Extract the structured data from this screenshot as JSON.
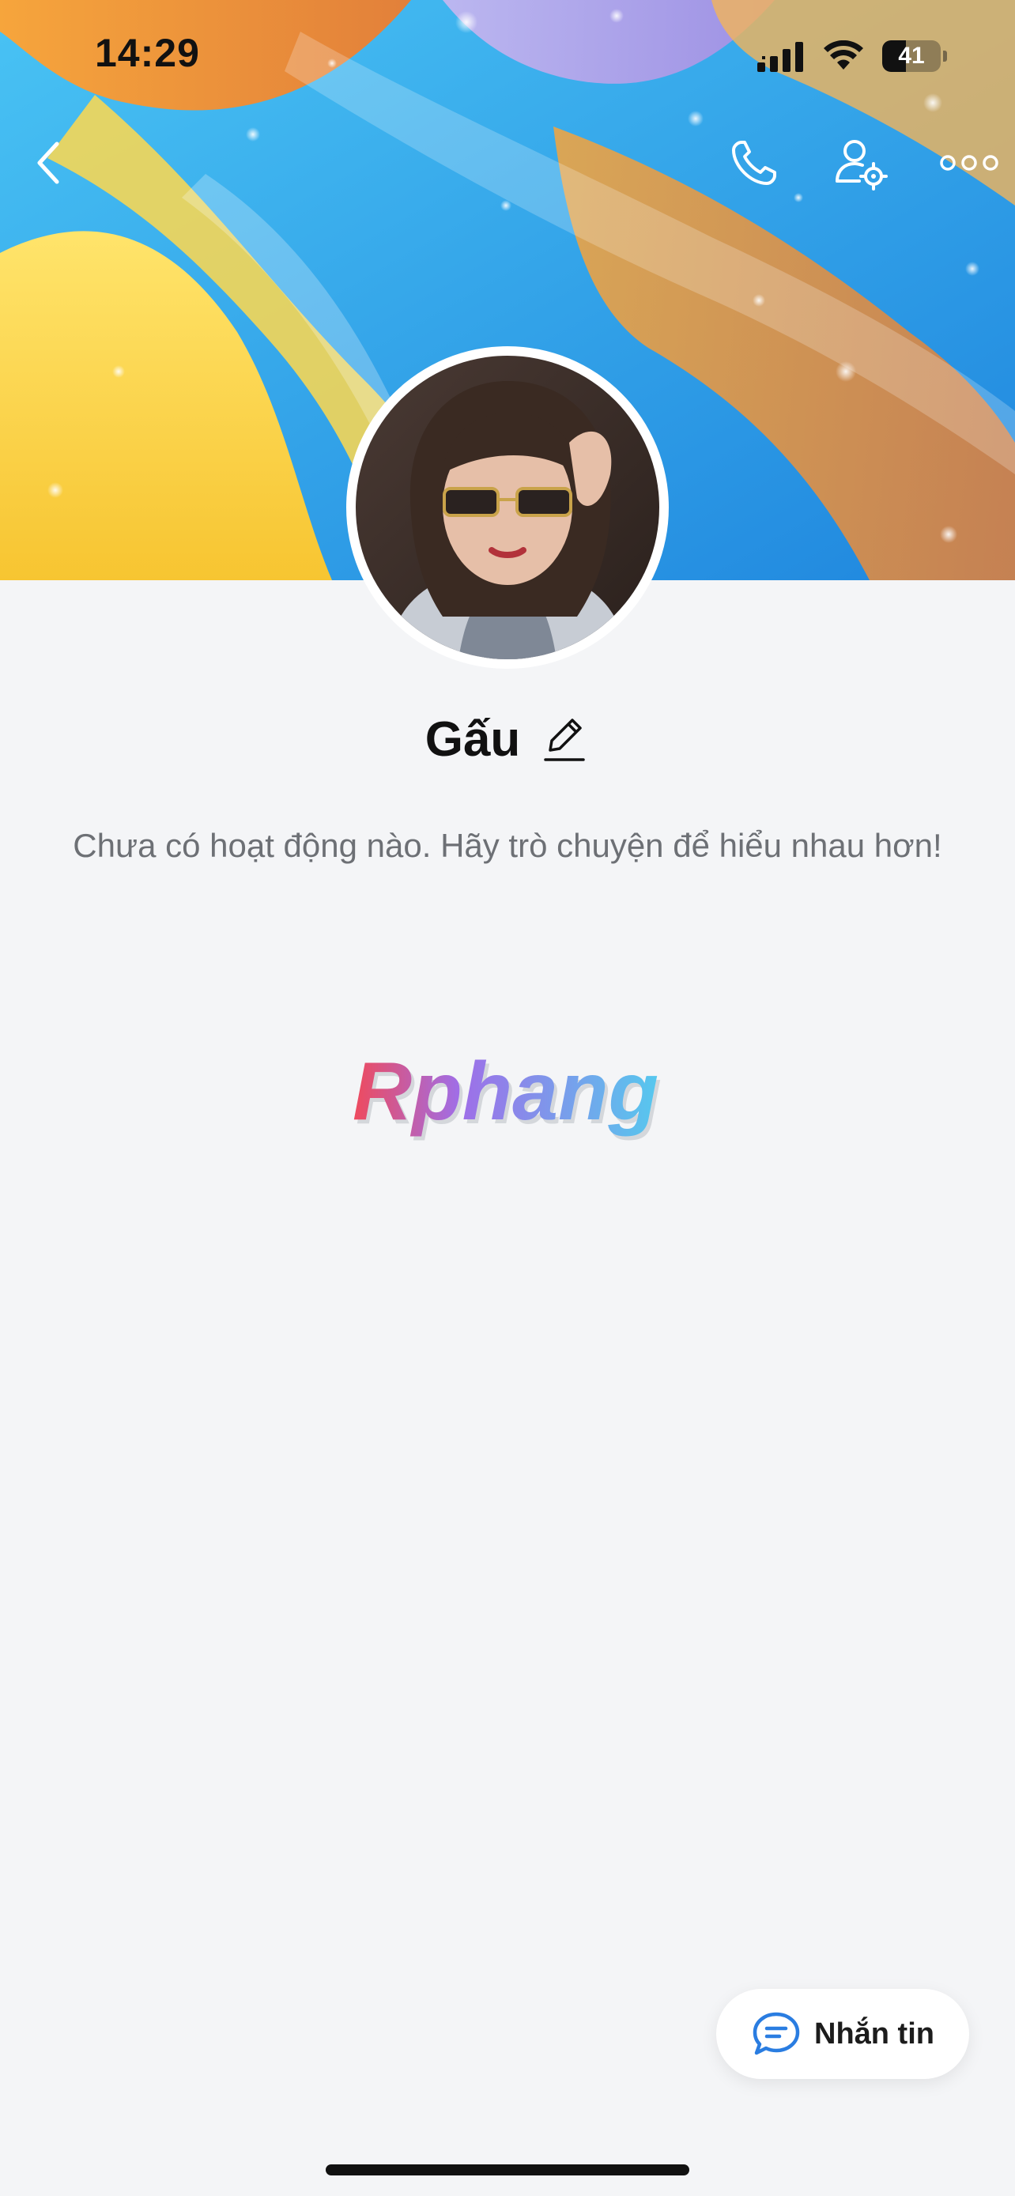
{
  "status_bar": {
    "time": "14:29",
    "battery_level": "41",
    "icons": [
      "cellular-signal-icon",
      "wifi-icon",
      "battery-icon"
    ]
  },
  "nav": {
    "icons": [
      "back-chevron-icon",
      "phone-icon",
      "user-settings-icon",
      "more-dots-icon"
    ]
  },
  "profile": {
    "name": "Gấu",
    "edit_icon": "pencil-icon",
    "empty_activity_text": "Chưa có hoạt động nào. Hãy trò chuyện để hiểu nhau hơn!"
  },
  "watermark": {
    "text": "Rphang"
  },
  "message_button": {
    "label": "Nhắn tin",
    "icon": "chat-bubble-icon"
  },
  "colors": {
    "accent_blue": "#2a7de1",
    "background": "#f4f5f7",
    "text_primary": "#111111",
    "text_secondary": "#6d7075"
  }
}
